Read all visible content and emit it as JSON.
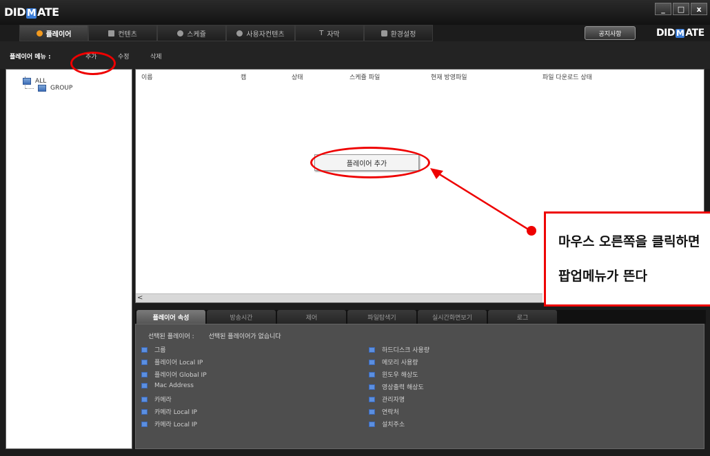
{
  "app": {
    "logo_left": "DIDMATE",
    "logo_right": "DIDMATE"
  },
  "window_buttons": [
    "_",
    "□",
    "x"
  ],
  "top_tabs": [
    {
      "label": "플레이어",
      "icon": "play-icon"
    },
    {
      "label": "컨텐츠",
      "icon": "grid-icon"
    },
    {
      "label": "스케쥴",
      "icon": "clock-icon"
    },
    {
      "label": "사용자컨텐츠",
      "icon": "user-icon"
    },
    {
      "label": "자막",
      "icon": "text-icon"
    },
    {
      "label": "환경설정",
      "icon": "settings-icon"
    }
  ],
  "notice_button": "공지사항",
  "submenu": {
    "label": "플레이어 메뉴 :",
    "add": "추가",
    "edit": "수정",
    "delete": "삭제"
  },
  "tree": [
    {
      "label": "ALL"
    },
    {
      "label": "GROUP"
    }
  ],
  "columns": [
    "이름",
    "캠",
    "상태",
    "스케쥴 파일",
    "현재 방영파일",
    "파일 다운로드 상태"
  ],
  "popup": {
    "item": "플레이어 추가"
  },
  "bottom_tabs": [
    "플레이어 속성",
    "방송시간",
    "제어",
    "파일탐색기",
    "실시간화면보기",
    "로그"
  ],
  "selected": {
    "label": "선택된 플레이어 :",
    "value": "선택된 플레이어가 없습니다"
  },
  "props_left": [
    "그룹",
    "플레이어 Local IP",
    "플레이어 Global IP",
    "Mac Address",
    "카메라",
    "카메라 Local IP",
    "카메라 Local IP"
  ],
  "props_right": [
    "하드디스크 사용량",
    "메모리 사용량",
    "윈도우 해상도",
    "영상출력 해상도",
    "관리자명",
    "연락처",
    "설치주소"
  ],
  "callout": {
    "line1": "마우스 오른쪽을 클릭하면",
    "line2": "팝업메뉴가 뜬다"
  },
  "colors": {
    "annotation": "#e00000",
    "accent": "#f39a1e",
    "bullet": "#5b8fe0"
  }
}
